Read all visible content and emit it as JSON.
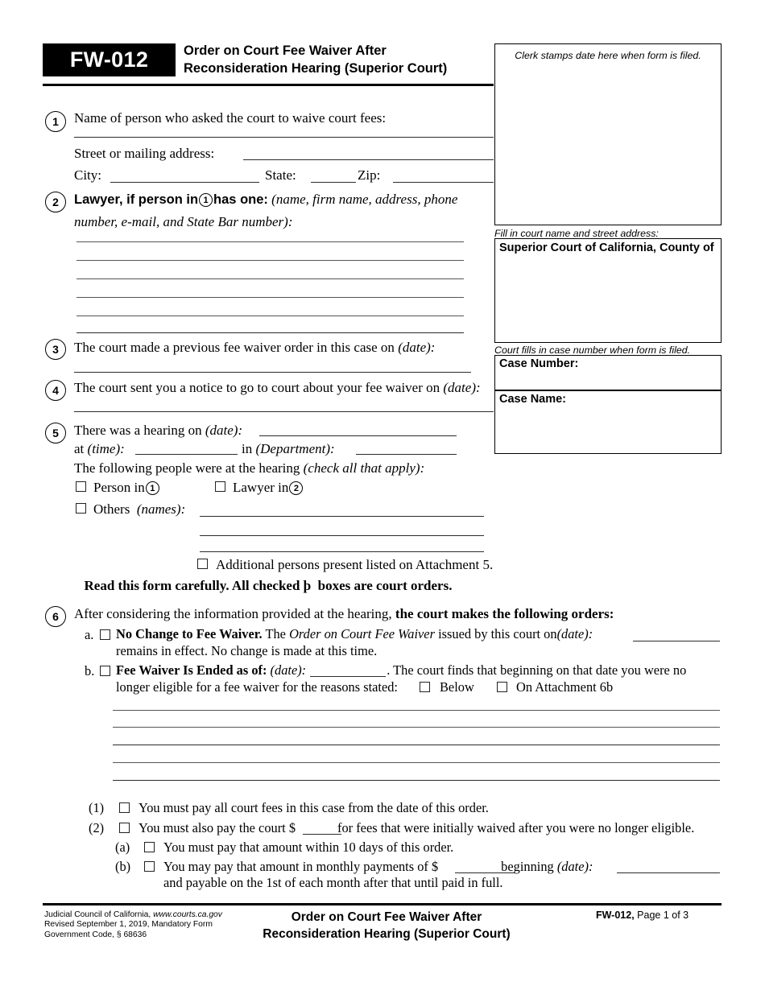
{
  "header": {
    "form_number": "FW-012",
    "title_line1": "Order on Court Fee Waiver After",
    "title_line2": "Reconsideration Hearing (Superior Court)"
  },
  "right_column": {
    "stamp_caption": "Clerk stamps date here when form is filed.",
    "court_caption": "Fill in court name and street address:",
    "court_label": "Superior Court of California, County of",
    "case_caption": "Court fills in case number when form is filed.",
    "case_number_label": "Case Number:",
    "case_name_label": "Case Name:"
  },
  "item1": {
    "number": "1",
    "name_label": "Name of person who asked the court to waive court fees:",
    "street_label": "Street or mailing address:",
    "city_label": "City:",
    "state_label": "State:",
    "zip_label": "Zip:"
  },
  "item2": {
    "number": "2",
    "bold_pre": "Lawyer, if person in",
    "circle_ref": "1",
    "bold_post": "has one:",
    "italic_line1": "(name, firm name, address, phone",
    "italic_line2": "number, e-mail, and State Bar number):",
    "blank_lines": 5
  },
  "item3": {
    "number": "3",
    "text": "The court made a previous fee waiver order in this case on",
    "italic": "(date):"
  },
  "item4": {
    "number": "4",
    "text": "The court sent you a notice to go to court about your fee waiver on",
    "italic": "(date):"
  },
  "item5": {
    "number": "5",
    "hearing_text": "There was a hearing on",
    "hearing_italic": "(date):",
    "at_label": "at",
    "time_italic": "(time):",
    "in_label": "in",
    "dept_italic": "(Department):",
    "people_text": "The following people were at the hearing",
    "people_italic": "(check all that apply):",
    "person_in_label": "Person in",
    "person_in_ref": "1",
    "lawyer_in_label": "Lawyer in",
    "lawyer_in_ref": "2",
    "others_label": "Others",
    "others_italic": "(names):",
    "attachment_label": "Additional persons present listed on Attachment 5."
  },
  "notice": {
    "pre": "Read this form carefully. All checked",
    "checkbox_glyph": "þ",
    "post": "boxes are court orders."
  },
  "item6": {
    "number": "6",
    "intro_normal": "After considering the information provided at the hearing,",
    "intro_bold": "the court makes the following orders:",
    "a": {
      "marker": "a.",
      "bold": "No Change to Fee Waiver.",
      "text1": "The",
      "italic1": "Order on Court Fee Waiver",
      "text2": "issued by this court on",
      "italic2": "(date):",
      "line2": "remains in effect. No change is made at this time."
    },
    "b": {
      "marker": "b.",
      "bold": "Fee Waiver Is Ended as of:",
      "italic1": "(date):",
      "text1": ". The court finds that beginning on that date you were no",
      "line2_pre": "longer eligible for a fee waiver for the reasons stated:",
      "opt_below": "Below",
      "opt_attachment": "On Attachment 6b",
      "blank_lines": 5
    },
    "sub1": {
      "marker": "(1)",
      "text": "You must pay all court fees in this case from the date of this order."
    },
    "sub2": {
      "marker": "(2)",
      "text_pre": "You must also pay the court $",
      "text_post": "for fees that were initially waived after you were no longer eligible."
    },
    "sub2a": {
      "marker": "(a)",
      "text": "You must pay that amount within 10 days of this order."
    },
    "sub2b": {
      "marker": "(b)",
      "text_pre": "You may pay that amount in monthly payments of $",
      "text_mid": "beginning",
      "italic": "(date):",
      "line2": "and payable on the 1st of each month after that until paid in full."
    }
  },
  "footer": {
    "left_line1_normal": "Judicial Council of California,",
    "left_line1_italic": "www.courts.ca.gov",
    "left_line2": "Revised September 1, 2019, Mandatory Form",
    "left_line3": "Government Code, § 68636",
    "center_line1": "Order on Court Fee Waiver After",
    "center_line2": "Reconsideration Hearing (Superior Court)",
    "right_bold": "FW-012,",
    "right_normal": "Page 1 of 3"
  }
}
